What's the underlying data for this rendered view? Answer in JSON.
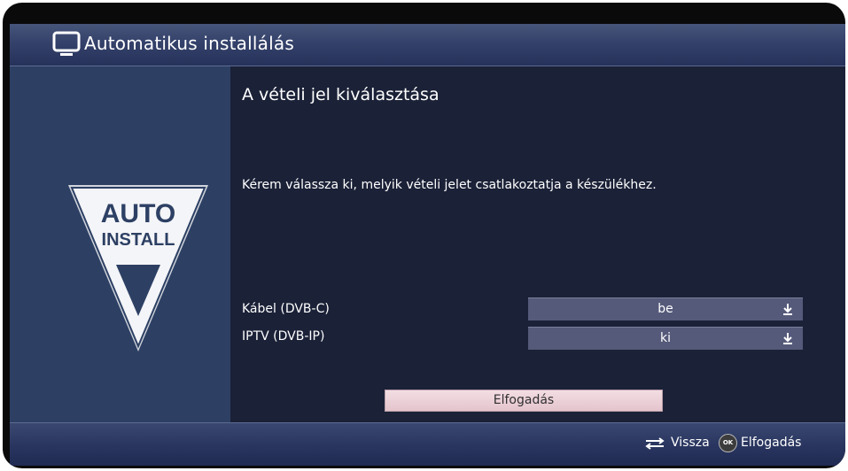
{
  "title_bar": {
    "title": "Automatikus installálás",
    "icon": "tv-icon"
  },
  "sidebar": {
    "logo_line1": "AUTO",
    "logo_line2": "INSTALL"
  },
  "main": {
    "heading": "A vételi jel kiválasztása",
    "description": "Kérem válassza ki, melyik vételi jelet csatlakoztatja a készülékhez.",
    "options": [
      {
        "label": "Kábel (DVB-C)",
        "value": "be"
      },
      {
        "label": "IPTV (DVB-IP)",
        "value": "ki"
      }
    ],
    "accept_button": "Elfogadás"
  },
  "footer": {
    "back_label": "Vissza",
    "ok_badge": "OK",
    "ok_label": "Elfogadás"
  },
  "colors": {
    "background": "#1b2137",
    "sidebar": "#2d4064",
    "select_bg": "#555a7a",
    "button_bg": "#ead0d7"
  }
}
